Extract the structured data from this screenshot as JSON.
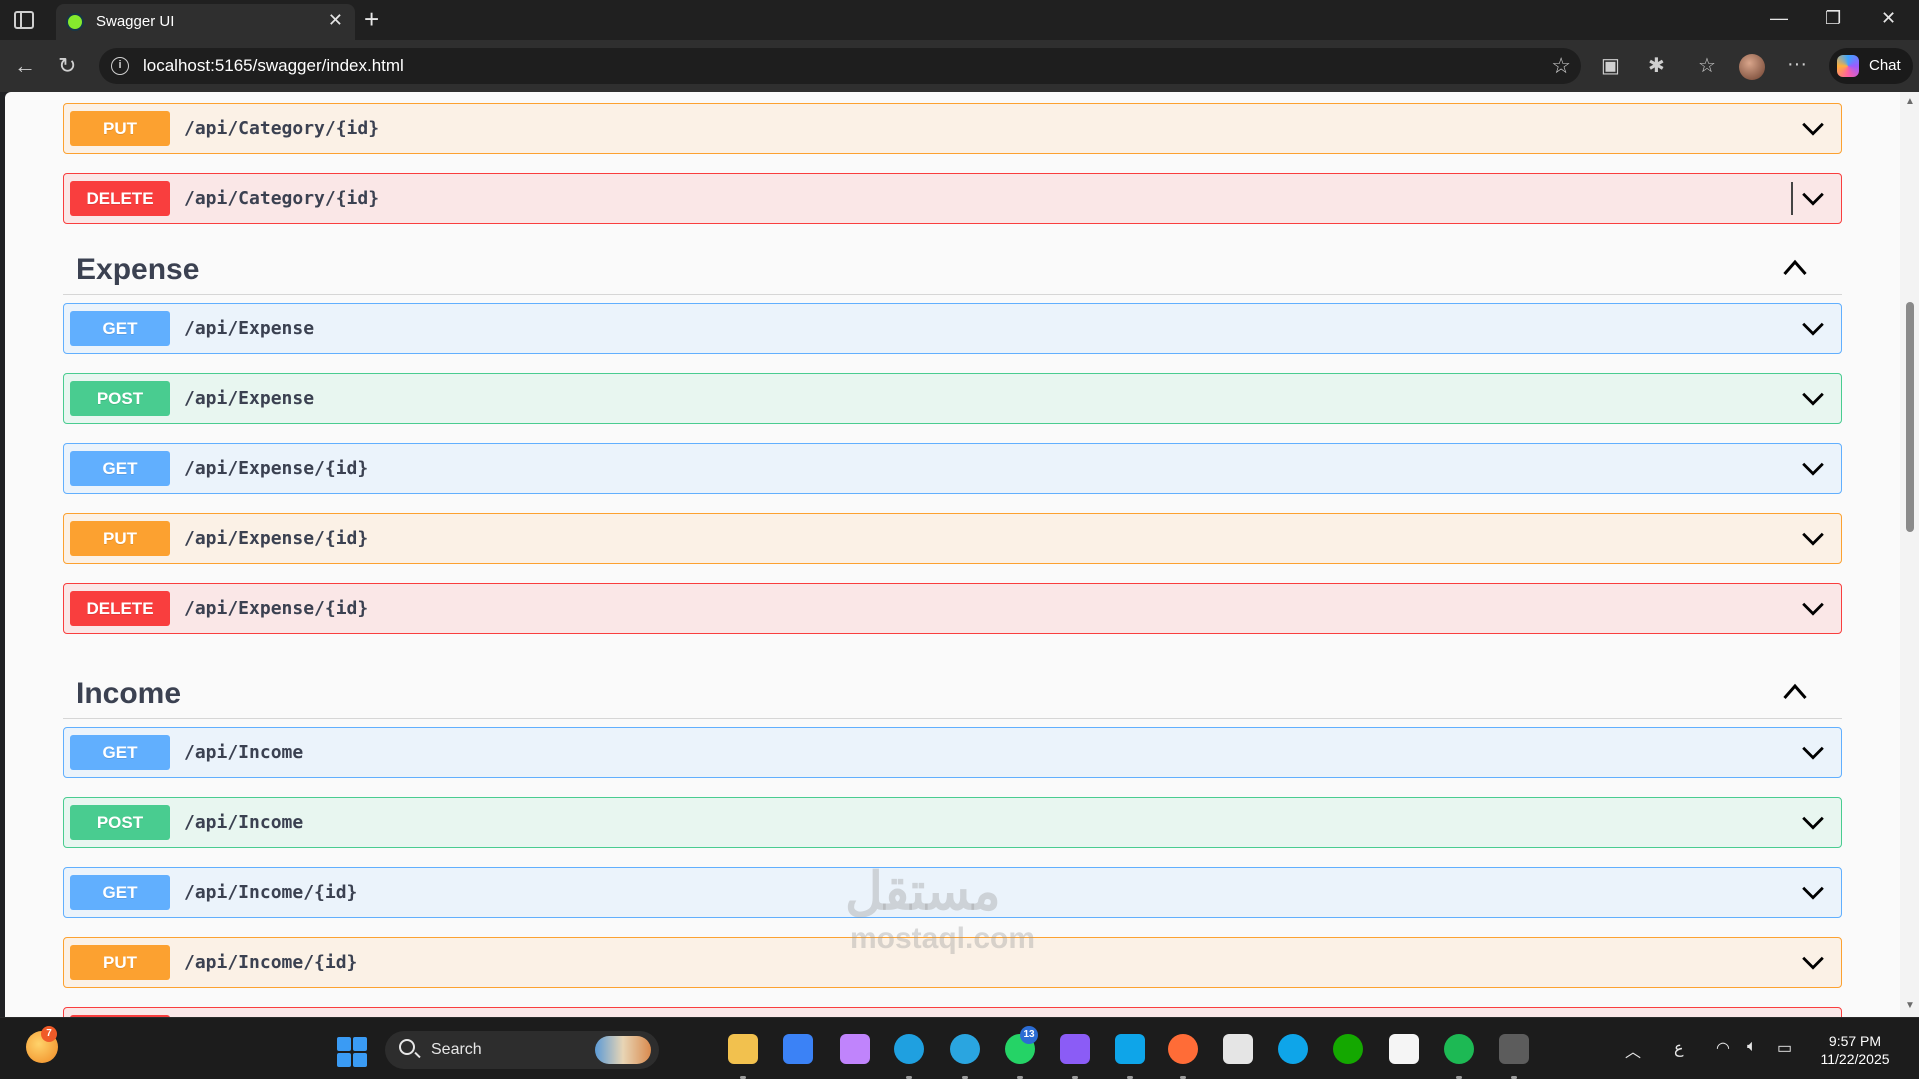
{
  "browser": {
    "tab_title": "Swagger UI",
    "tab_close": "✕",
    "new_tab": "+",
    "url": "localhost:5165/swagger/index.html",
    "chat_label": "Chat",
    "window_controls": [
      "—",
      "❐",
      "✕"
    ]
  },
  "swagger": {
    "top_ops": [
      {
        "method": "PUT",
        "path": "/api/Category/{id}"
      },
      {
        "method": "DELETE",
        "path": "/api/Category/{id}"
      }
    ],
    "sections": [
      {
        "title": "Expense",
        "ops": [
          {
            "method": "GET",
            "path": "/api/Expense"
          },
          {
            "method": "POST",
            "path": "/api/Expense"
          },
          {
            "method": "GET",
            "path": "/api/Expense/{id}"
          },
          {
            "method": "PUT",
            "path": "/api/Expense/{id}"
          },
          {
            "method": "DELETE",
            "path": "/api/Expense/{id}"
          }
        ]
      },
      {
        "title": "Income",
        "ops": [
          {
            "method": "GET",
            "path": "/api/Income"
          },
          {
            "method": "POST",
            "path": "/api/Income"
          },
          {
            "method": "GET",
            "path": "/api/Income/{id}"
          },
          {
            "method": "PUT",
            "path": "/api/Income/{id}"
          }
        ]
      }
    ],
    "colors": {
      "get": "#61affe",
      "post": "#49cc90",
      "put": "#fca130",
      "delete": "#f93e3e"
    }
  },
  "watermark": {
    "text": "مستقل",
    "sub": "mostaql.com"
  },
  "taskbar": {
    "weather_badge": "7",
    "search_label": "Search",
    "whatsapp_badge": "13",
    "keyboard_lang": "ع",
    "time": "9:57 PM",
    "date": "11/22/2025",
    "icons": [
      "file-explorer-icon",
      "store-icon",
      "copilot-icon",
      "edge-icon",
      "telegram-icon",
      "whatsapp-icon",
      "visual-studio-icon",
      "vscode-icon",
      "postman-icon",
      "chatgpt-icon",
      "c-app-icon",
      "upwork-icon",
      "notion-icon",
      "spotify-icon",
      "terminal-icon"
    ]
  }
}
